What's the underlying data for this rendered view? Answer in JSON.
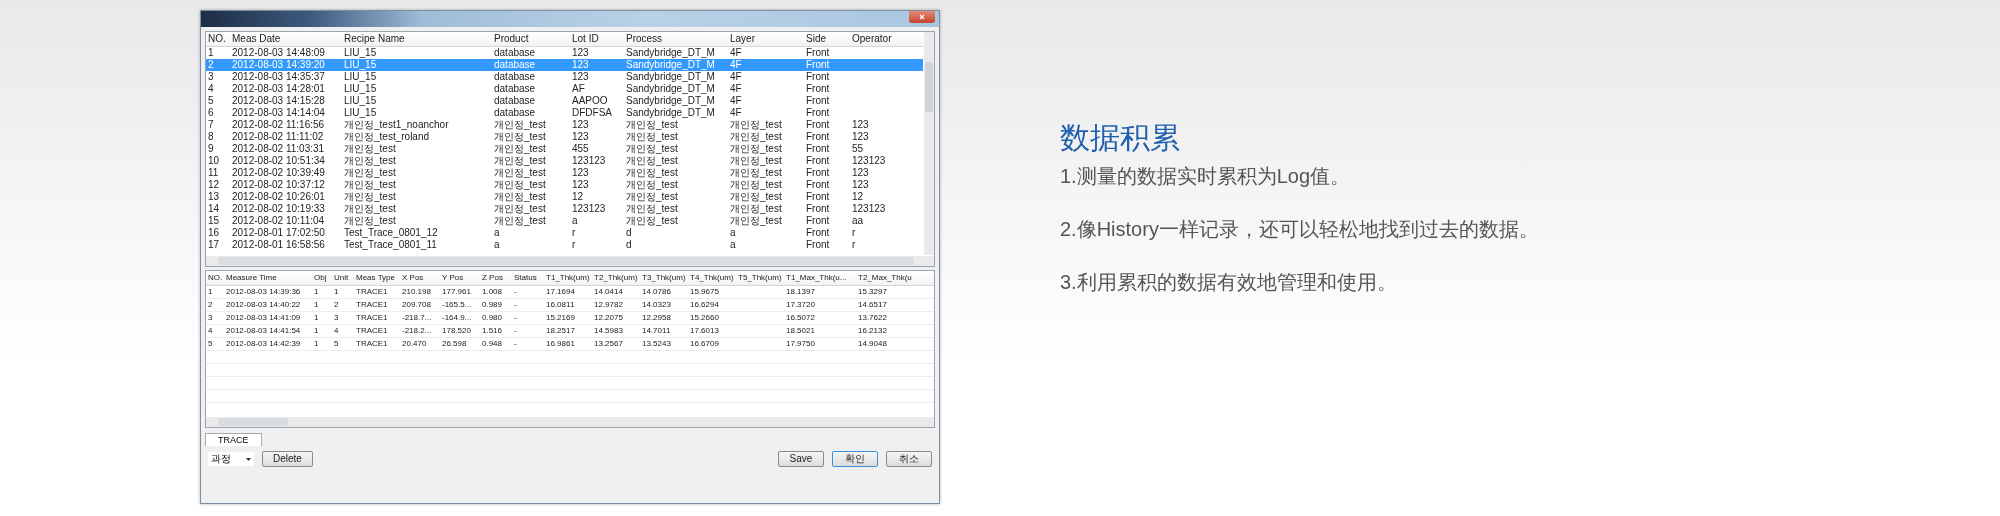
{
  "app_window": {
    "top_table": {
      "columns": [
        "NO.",
        "Meas Date",
        "Recipe Name",
        "Product",
        "Lot ID",
        "Process",
        "Layer",
        "Side",
        "Operator"
      ],
      "rows": [
        {
          "selected": false,
          "cells": [
            "1",
            "2012-08-03 14:48:09",
            "LIU_15",
            "database",
            "123",
            "Sandybridge_DT_M",
            "4F",
            "Front",
            null
          ]
        },
        {
          "selected": true,
          "cells": [
            "2",
            "2012-08-03 14:39:20",
            "LIU_15",
            "database",
            "123",
            "Sandybridge_DT_M",
            "4F",
            "Front",
            null
          ]
        },
        {
          "selected": false,
          "cells": [
            "3",
            "2012-08-03 14:35:37",
            "LIU_15",
            "database",
            "123",
            "Sandybridge_DT_M",
            "4F",
            "Front",
            null
          ]
        },
        {
          "selected": false,
          "cells": [
            "4",
            "2012-08-03 14:28:01",
            "LIU_15",
            "database",
            "AF",
            "Sandybridge_DT_M",
            "4F",
            "Front",
            null
          ]
        },
        {
          "selected": false,
          "cells": [
            "5",
            "2012-08-03 14:15:28",
            "LIU_15",
            "database",
            "AAPOO",
            "Sandybridge_DT_M",
            "4F",
            "Front",
            null
          ]
        },
        {
          "selected": false,
          "cells": [
            "6",
            "2012-08-03 14:14:04",
            "LIU_15",
            "database",
            "DFDFSA",
            "Sandybridge_DT_M",
            "4F",
            "Front",
            null
          ]
        },
        {
          "selected": false,
          "cells": [
            "7",
            "2012-08-02 11:16:56",
            "개인정_test1_noanchor",
            "개인정_test",
            "123",
            "개인정_test",
            "개인정_test",
            "Front",
            "123"
          ]
        },
        {
          "selected": false,
          "cells": [
            "8",
            "2012-08-02 11:11:02",
            "개인정_test_roland",
            "개인정_test",
            "123",
            "개인정_test",
            "개인정_test",
            "Front",
            "123"
          ]
        },
        {
          "selected": false,
          "cells": [
            "9",
            "2012-08-02 11:03:31",
            "개인정_test",
            "개인정_test",
            "455",
            "개인정_test",
            "개인정_test",
            "Front",
            "55"
          ]
        },
        {
          "selected": false,
          "cells": [
            "10",
            "2012-08-02 10:51:34",
            "개인정_test",
            "개인정_test",
            "123123",
            "개인정_test",
            "개인정_test",
            "Front",
            "123123"
          ]
        },
        {
          "selected": false,
          "cells": [
            "11",
            "2012-08-02 10:39:49",
            "개인정_test",
            "개인정_test",
            "123",
            "개인정_test",
            "개인정_test",
            "Front",
            "123"
          ]
        },
        {
          "selected": false,
          "cells": [
            "12",
            "2012-08-02 10:37:12",
            "개인정_test",
            "개인정_test",
            "123",
            "개인정_test",
            "개인정_test",
            "Front",
            "123"
          ]
        },
        {
          "selected": false,
          "cells": [
            "13",
            "2012-08-02 10:26:01",
            "개인정_test",
            "개인정_test",
            "12",
            "개인정_test",
            "개인정_test",
            "Front",
            "12"
          ]
        },
        {
          "selected": false,
          "cells": [
            "14",
            "2012-08-02 10:19:33",
            "개인정_test",
            "개인정_test",
            "123123",
            "개인정_test",
            "개인정_test",
            "Front",
            "123123"
          ]
        },
        {
          "selected": false,
          "cells": [
            "15",
            "2012-08-02 10:11:04",
            "개인정_test",
            "개인정_test",
            "a",
            "개인정_test",
            "개인정_test",
            "Front",
            "aa"
          ]
        },
        {
          "selected": false,
          "cells": [
            "16",
            "2012-08-01 17:02:50",
            "Test_Trace_0801_12",
            "a",
            "r",
            "d",
            "a",
            "Front",
            "r"
          ]
        },
        {
          "selected": false,
          "cells": [
            "17",
            "2012-08-01 16:58:56",
            "Test_Trace_0801_11",
            "a",
            "r",
            "d",
            "a",
            "Front",
            "r"
          ]
        }
      ]
    },
    "bottom_table": {
      "columns": [
        "NO.",
        "Measure Time",
        "Obj",
        "Unit",
        "Meas Type",
        "X Pos",
        "Y Pos",
        "Z Pos",
        "Status",
        "T1_Thk(um)",
        "T2_Thk(um)",
        "T3_Thk(um)",
        "T4_Thk(um)",
        "T5_Thk(um)",
        "T1_Max_Thk(u...",
        "T2_Max_Thk(u"
      ],
      "rows": [
        [
          "1",
          "2012-08-03 14:39:36",
          "1",
          "1",
          "TRACE1",
          "210.198",
          "177.961",
          "1.008",
          "-",
          "17.1694",
          "14.0414",
          "14.0786",
          "15.9675",
          null,
          "18.1397",
          "15.3297"
        ],
        [
          "2",
          "2012-08-03 14:40:22",
          "1",
          "2",
          "TRACE1",
          "209.708",
          "-165.5...",
          "0.989",
          "-",
          "16.0811",
          "12.9782",
          "14.0323",
          "16.6294",
          null,
          "17.3720",
          "14.6517"
        ],
        [
          "3",
          "2012-08-03 14:41:09",
          "1",
          "3",
          "TRACE1",
          "-218.7...",
          "-164.9...",
          "0.980",
          "-",
          "15.2169",
          "12.2075",
          "12.2958",
          "15.2660",
          null,
          "16.5072",
          "13.7622"
        ],
        [
          "4",
          "2012-08-03 14:41:54",
          "1",
          "4",
          "TRACE1",
          "-218.2...",
          "178.520",
          "1.516",
          "-",
          "18.2517",
          "14.5983",
          "14.7011",
          "17.6013",
          null,
          "18.5021",
          "16.2132"
        ],
        [
          "5",
          "2012-08-03 14:42:39",
          "1",
          "5",
          "TRACE1",
          "20.470",
          "26.598",
          "0.948",
          "-",
          "16.9861",
          "13.2567",
          "13.5243",
          "16.6709",
          null,
          "17.9750",
          "14.9048"
        ]
      ]
    },
    "tabs": [
      {
        "label": "TRACE",
        "selected": true
      }
    ],
    "dropdown": {
      "value": "과정"
    },
    "delete_button": "Delete",
    "dialog_buttons": [
      "Save",
      "확인",
      "취소"
    ]
  },
  "feature": {
    "title": "数据积累",
    "points": [
      "1.测量的数据实时累积为Log值。",
      "2.像History一样记录，还可以轻松地找到过去的数据。",
      "3.利用累积的数据有效地管理和使用。"
    ]
  }
}
